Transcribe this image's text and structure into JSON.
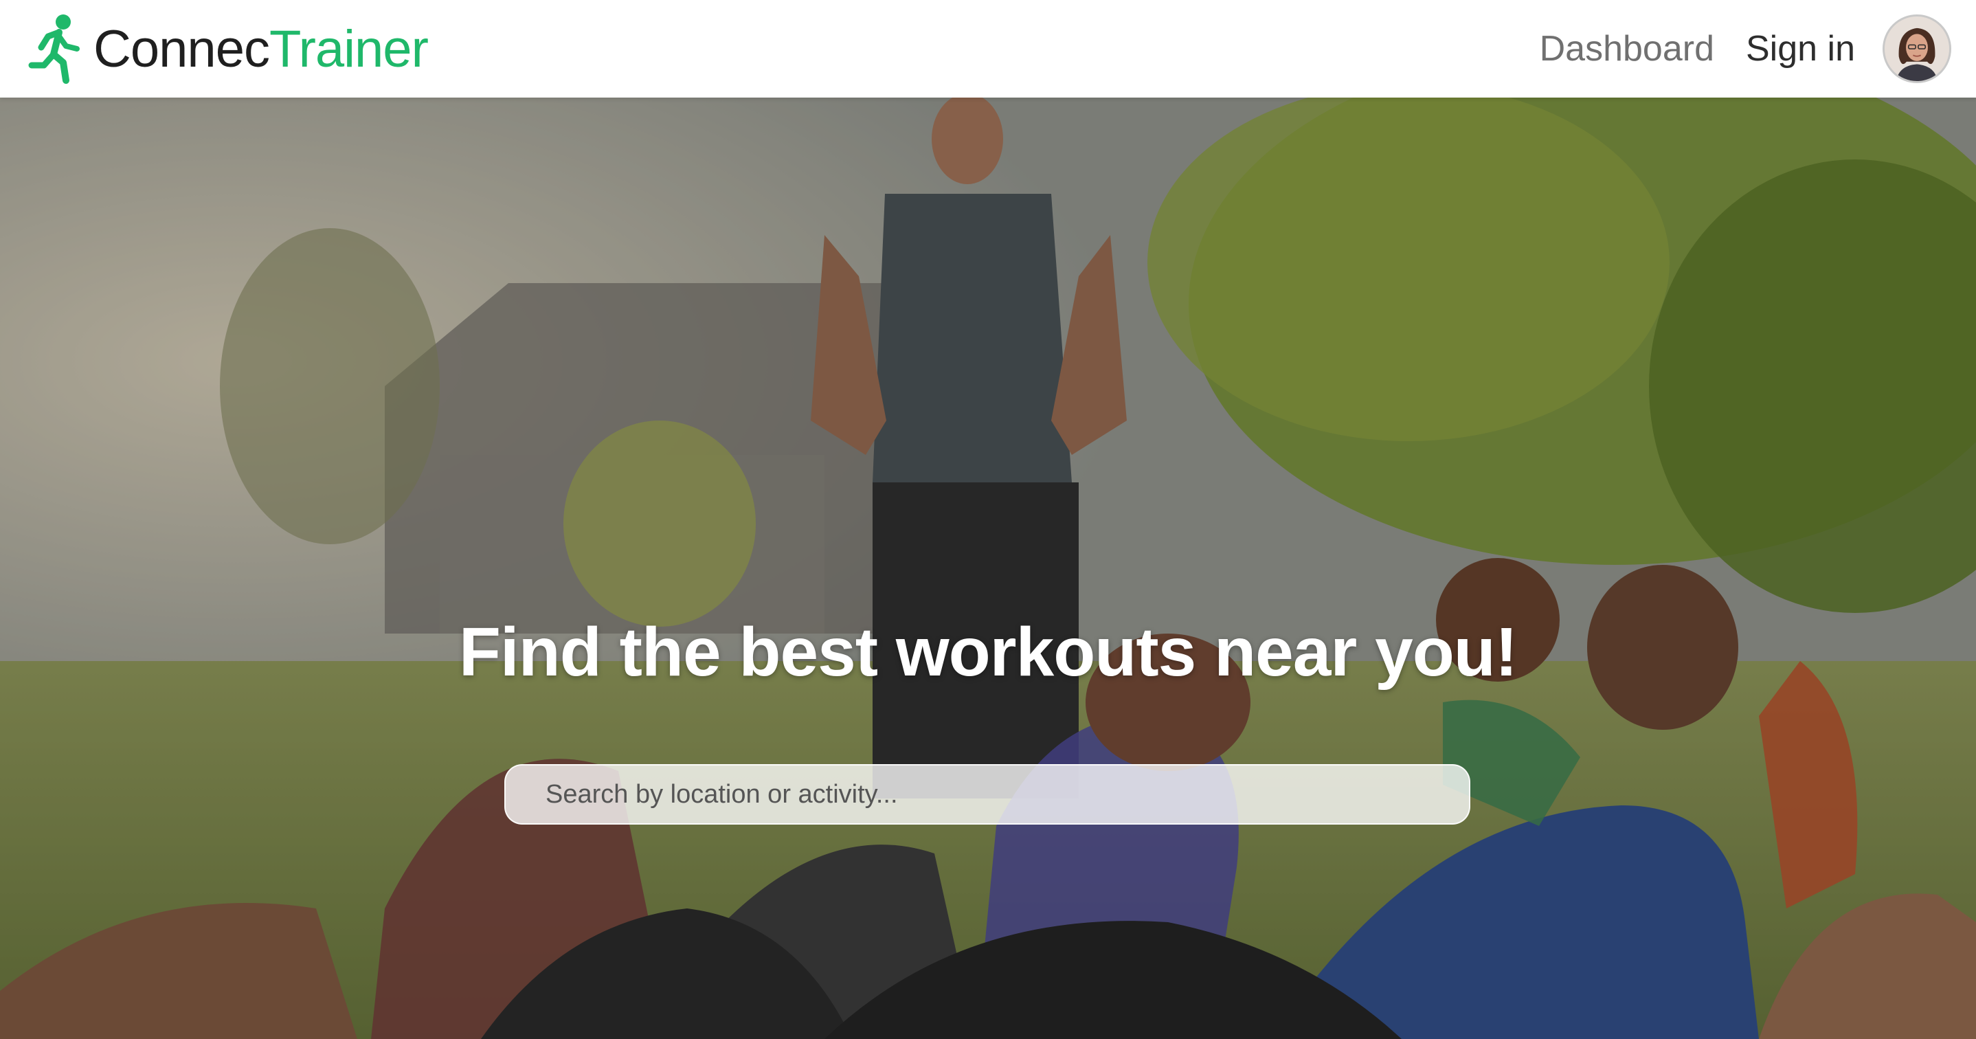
{
  "brand": {
    "name_part1": "Connec",
    "name_part2": "Trainer",
    "icon": "running-person-icon",
    "accent_color": "#1fb86a"
  },
  "nav": {
    "dashboard_label": "Dashboard",
    "signin_label": "Sign in"
  },
  "hero": {
    "heading": "Find the best workouts near you!",
    "search_placeholder": "Search by location or activity..."
  }
}
